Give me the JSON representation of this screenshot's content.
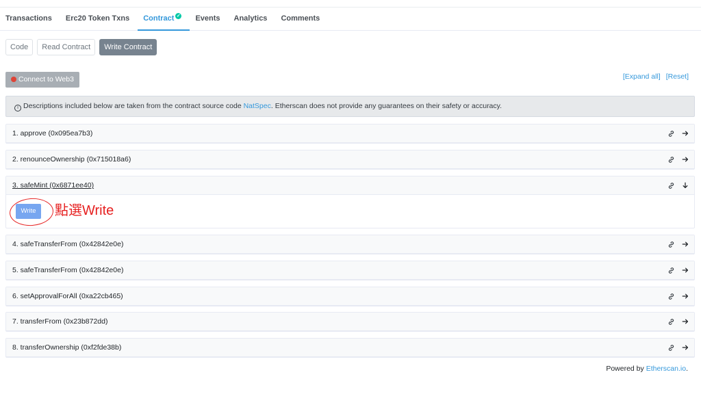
{
  "tabs": [
    {
      "label": "Transactions"
    },
    {
      "label": "Erc20 Token Txns"
    },
    {
      "label": "Contract",
      "active": true
    },
    {
      "label": "Events"
    },
    {
      "label": "Analytics"
    },
    {
      "label": "Comments"
    }
  ],
  "subtabs": [
    {
      "label": "Code"
    },
    {
      "label": "Read Contract"
    },
    {
      "label": "Write Contract",
      "active": true
    }
  ],
  "connect_label": "Connect to Web3",
  "expand_all": "[Expand all]",
  "reset": "[Reset]",
  "notice": {
    "prefix": "Descriptions included below are taken from the contract source code ",
    "link": "NatSpec",
    "suffix": ". Etherscan does not provide any guarantees on their safety or accuracy."
  },
  "functions": [
    {
      "label": "1. approve (0x095ea7b3)"
    },
    {
      "label": "2. renounceOwnership (0x715018a6)"
    },
    {
      "label": "3. safeMint (0x6871ee40)",
      "expanded": true
    },
    {
      "label": "4. safeTransferFrom (0x42842e0e)"
    },
    {
      "label": "5. safeTransferFrom (0x42842e0e)"
    },
    {
      "label": "6. setApprovalForAll (0xa22cb465)"
    },
    {
      "label": "7. transferFrom (0x23b872dd)"
    },
    {
      "label": "8. transferOwnership (0xf2fde38b)"
    }
  ],
  "write_label": "Write",
  "annotation": "點選Write",
  "footer": {
    "prefix": "Powered by ",
    "link": "Etherscan.io",
    "suffix": "."
  },
  "colors": {
    "accent": "#3498db",
    "annotation": "#e62020",
    "connect_dot": "#de4437"
  }
}
